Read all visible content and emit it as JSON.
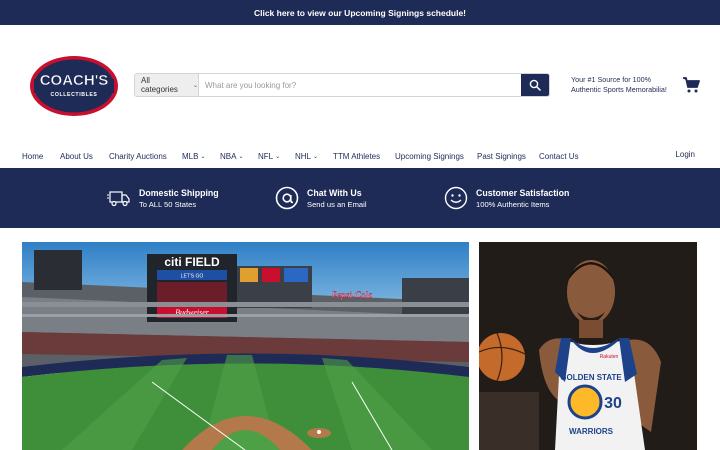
{
  "announcement": {
    "text": "Click here to view our Upcoming Signings schedule!"
  },
  "logo": {
    "line1": "COACH'S",
    "line2": "COLLECTIBLES"
  },
  "search": {
    "category_label": "All categories",
    "placeholder": "What are you looking for?",
    "icon": "search-icon"
  },
  "tagline": {
    "line1": "Your #1 Source for 100%",
    "line2": "Authentic Sports Memorabilia!"
  },
  "cart": {
    "icon": "cart-icon"
  },
  "nav": {
    "items": [
      {
        "label": "Home",
        "dropdown": false
      },
      {
        "label": "About Us",
        "dropdown": false
      },
      {
        "label": "Charity Auctions",
        "dropdown": false
      },
      {
        "label": "MLB",
        "dropdown": true
      },
      {
        "label": "NBA",
        "dropdown": true
      },
      {
        "label": "NFL",
        "dropdown": true
      },
      {
        "label": "NHL",
        "dropdown": true
      },
      {
        "label": "TTM Athletes",
        "dropdown": false
      },
      {
        "label": "Upcoming Signings",
        "dropdown": false
      },
      {
        "label": "Past Signings",
        "dropdown": false
      },
      {
        "label": "Contact Us",
        "dropdown": false
      }
    ],
    "login": "Login"
  },
  "benefits": [
    {
      "title": "Domestic Shipping",
      "subtitle": "To ALL 50 States",
      "icon": "truck-icon"
    },
    {
      "title": "Chat With Us",
      "subtitle": "Send us an Email",
      "icon": "at-sign-icon"
    },
    {
      "title": "Customer Satisfaction",
      "subtitle": "100% Authentic Items",
      "icon": "smiley-icon"
    }
  ],
  "slides": {
    "stadium": {
      "scoreboard_text": "citi FIELD",
      "sign1": "LET'S GO",
      "sign2": "Budweiser",
      "sign3": "Pepsi-Cola"
    },
    "player": {
      "jersey_line1": "GOLDEN STATE",
      "jersey_line2": "WARRIORS",
      "number": "30",
      "sponsor": "Rakuten"
    }
  },
  "colors": {
    "navy": "#1e2b57",
    "white": "#ffffff",
    "red": "#c8102e"
  }
}
